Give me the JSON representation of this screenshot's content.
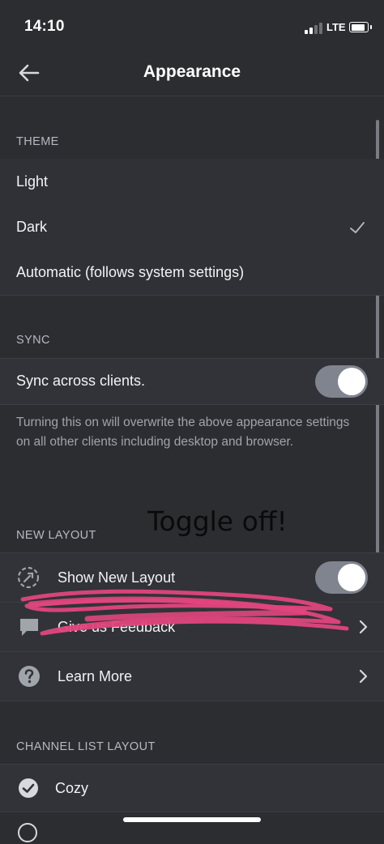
{
  "status_bar": {
    "time": "14:10",
    "network": "LTE"
  },
  "nav": {
    "title": "Appearance"
  },
  "theme": {
    "header": "THEME",
    "options": [
      {
        "label": "Light",
        "selected": false
      },
      {
        "label": "Dark",
        "selected": true
      },
      {
        "label": "Automatic (follows system settings)",
        "selected": false
      }
    ]
  },
  "sync": {
    "header": "SYNC",
    "toggle_label": "Sync across clients.",
    "toggle_on": true,
    "helper": "Turning this on will overwrite the above appearance settings on all other clients including desktop and browser."
  },
  "annotation": {
    "text": "Toggle off!"
  },
  "new_layout": {
    "header": "NEW LAYOUT",
    "items": [
      {
        "label": "Show New Layout",
        "icon": "new-layout-icon",
        "toggle_on": true
      },
      {
        "label": "Give us Feedback",
        "icon": "chat-bubble-icon"
      },
      {
        "label": "Learn More",
        "icon": "help-icon"
      }
    ]
  },
  "channel_list_layout": {
    "header": "CHANNEL LIST LAYOUT",
    "options": [
      {
        "label": "Cozy",
        "selected": true
      }
    ]
  },
  "colors": {
    "background": "#2b2d31",
    "row": "#313338",
    "toggle_track": "#80848e",
    "scribble": "#e0467c"
  }
}
